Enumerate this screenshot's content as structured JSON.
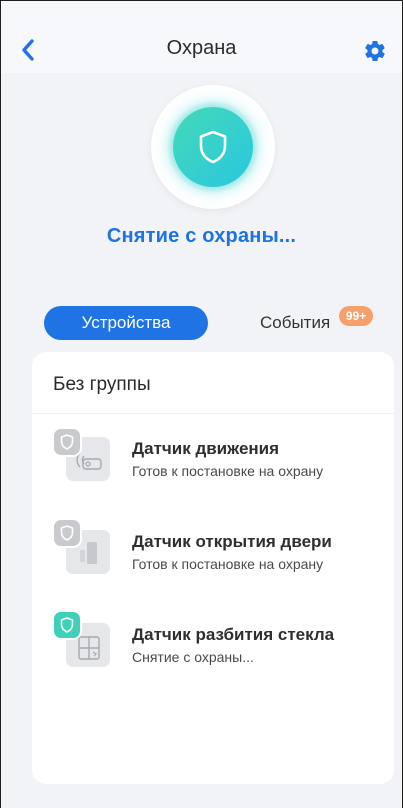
{
  "header": {
    "title": "Охрана",
    "back_icon": "chevron-left-icon",
    "settings_icon": "gear-icon"
  },
  "status": {
    "icon": "shield-icon",
    "text": "Снятие с охраны..."
  },
  "tabs": {
    "devices_label": "Устройства",
    "events_label": "События",
    "events_badge": "99+"
  },
  "group": {
    "title": "Без группы",
    "devices": [
      {
        "name": "Датчик движения",
        "status": "Готов к постановке на охрану",
        "icon": "motion-sensor-icon",
        "armed_state": "inactive"
      },
      {
        "name": "Датчик открытия двери",
        "status": "Готов к постановке на охрану",
        "icon": "door-sensor-icon",
        "armed_state": "inactive"
      },
      {
        "name": "Датчик разбития стекла",
        "status": "Снятие с охраны...",
        "icon": "glass-break-sensor-icon",
        "armed_state": "active"
      }
    ]
  },
  "colors": {
    "accent": "#1f73e5",
    "badge": "#f6a06b",
    "shield_active": "#3fd0b8",
    "shield_inactive": "#c9cacd"
  }
}
